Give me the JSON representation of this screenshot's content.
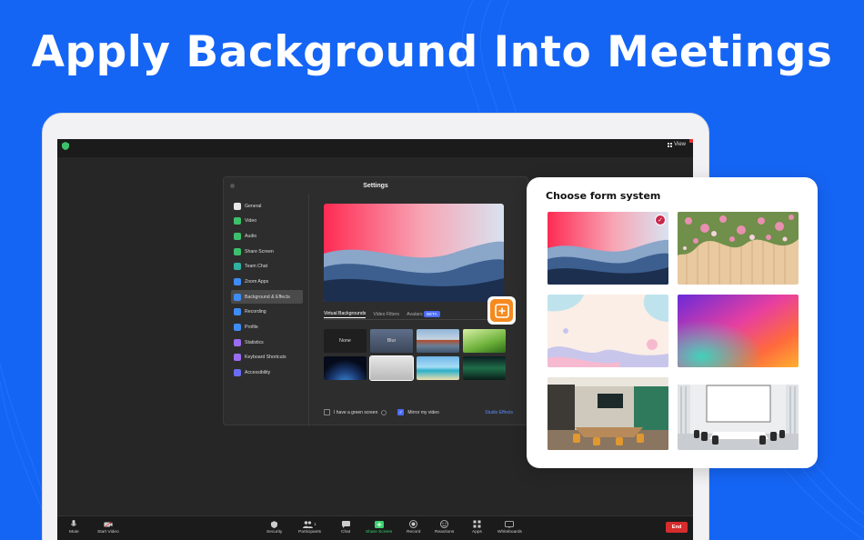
{
  "headline": "Apply Background Into Meetings",
  "window": {
    "view_label": "View"
  },
  "settings": {
    "title": "Settings",
    "sidebar": [
      {
        "label": "General",
        "color": "#e8e8e8",
        "active": false
      },
      {
        "label": "Video",
        "color": "#3cc16b",
        "active": false
      },
      {
        "label": "Audio",
        "color": "#3cc16b",
        "active": false
      },
      {
        "label": "Share Screen",
        "color": "#3cc16b",
        "active": false
      },
      {
        "label": "Team Chat",
        "color": "#2fb2a3",
        "active": false
      },
      {
        "label": "Zoom Apps",
        "color": "#3e8cf5",
        "active": false
      },
      {
        "label": "Background & Effects",
        "color": "#3e8cf5",
        "active": true
      },
      {
        "label": "Recording",
        "color": "#3e8cf5",
        "active": false
      },
      {
        "label": "Profile",
        "color": "#3e8cf5",
        "active": false
      },
      {
        "label": "Statistics",
        "color": "#9b6df2",
        "active": false
      },
      {
        "label": "Keyboard Shortcuts",
        "color": "#9b6df2",
        "active": false
      },
      {
        "label": "Accessibility",
        "color": "#6b6df2",
        "active": false
      }
    ],
    "tabs": {
      "virtual": "Virtual Backgrounds",
      "filters": "Video Filters",
      "avatars": "Avatars",
      "beta": "BETA"
    },
    "thumbs": {
      "none": "None",
      "blur": "Blur"
    },
    "green_screen": "I have a green screen",
    "mirror": "Mirror my video",
    "studio": "Studio Effects"
  },
  "toolbar": {
    "mute": "Mute",
    "start_video": "Start Video",
    "security": "Security",
    "participants": "Participants",
    "participants_count": "1",
    "chat": "Chat",
    "share_screen": "Share Screen",
    "record": "Record",
    "reactions": "Reactions",
    "apps": "Apps",
    "whiteboards": "Whiteboards",
    "end": "End"
  },
  "chooser": {
    "title": "Choose form system"
  },
  "colors": {
    "page_bg": "#1565f5",
    "accent_orange": "#f58a1f",
    "selected_badge": "#c9254a",
    "end_red": "#d62c2c"
  }
}
